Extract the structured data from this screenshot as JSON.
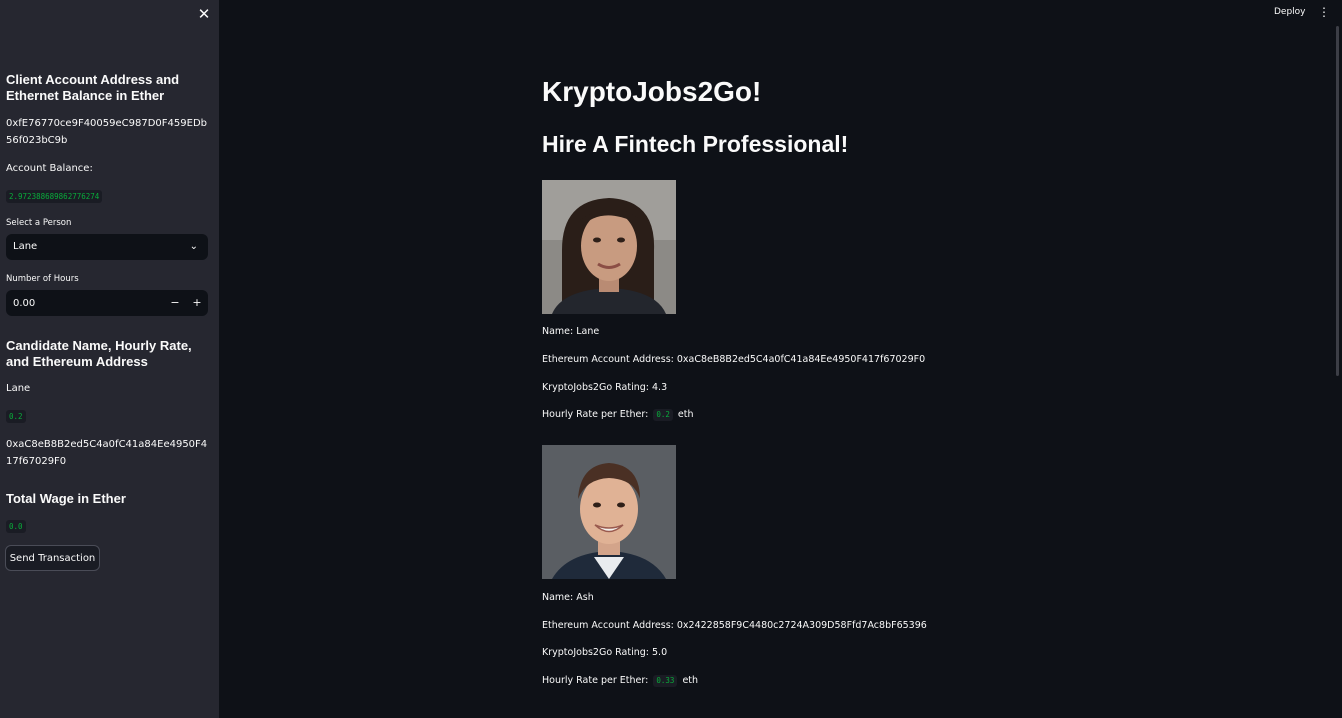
{
  "header": {
    "deploy_label": "Deploy"
  },
  "sidebar": {
    "client_heading": "Client Account Address and Ethernet Balance in Ether",
    "client_address": "0xfE76770ce9F40059eC987D0F459EDb56f023bC9b",
    "balance_label": "Account Balance:",
    "balance_value": "2.972388689862776274",
    "select_label": "Select a Person",
    "select_value": "Lane",
    "hours_label": "Number of Hours",
    "hours_value": "0.00",
    "candidate_heading": "Candidate Name, Hourly Rate, and Ethereum Address",
    "candidate_name": "Lane",
    "candidate_rate": "0.2",
    "candidate_address": "0xaC8eB8B2ed5C4a0fC41a84Ee4950F417f67029F0",
    "wage_heading": "Total Wage in Ether",
    "wage_value": "0.0",
    "send_label": "Send Transaction"
  },
  "main": {
    "title": "KryptoJobs2Go!",
    "subtitle": "Hire A Fintech Professional!",
    "candidates": [
      {
        "name": "Name: Lane",
        "address": "Ethereum Account Address: 0xaC8eB8B2ed5C4a0fC41a84Ee4950F417f67029F0",
        "rating": "KryptoJobs2Go Rating: 4.3",
        "rate_label": "Hourly Rate per Ether:",
        "rate_value": "0.2",
        "rate_unit": "eth"
      },
      {
        "name": "Name: Ash",
        "address": "Ethereum Account Address: 0x2422858F9C4480c2724A309D58Ffd7Ac8bF65396",
        "rating": "KryptoJobs2Go Rating: 5.0",
        "rate_label": "Hourly Rate per Ether:",
        "rate_value": "0.33",
        "rate_unit": "eth"
      }
    ]
  },
  "colors": {
    "background": "#0e1117",
    "sidebar": "#262730",
    "code_green": "#09ab3b"
  }
}
